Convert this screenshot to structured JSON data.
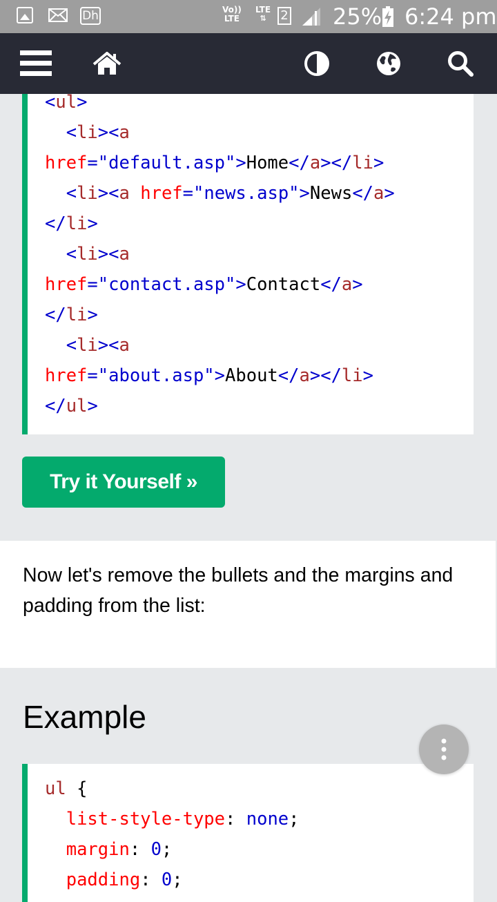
{
  "status_bar": {
    "dh_label": "Dh",
    "volte_top": "Vo))",
    "volte_bottom": "LTE",
    "lte_label": "LTE",
    "sim_slot": "2",
    "battery_percent": "25%",
    "time": "6:24 pm"
  },
  "nav": {
    "icons": [
      "menu-icon",
      "home-icon",
      "contrast-icon",
      "globe-icon",
      "search-icon"
    ],
    "background": "#282a35"
  },
  "code_example_1": {
    "lines": [
      [
        {
          "t": "tag",
          "v": "<"
        },
        {
          "t": "tn",
          "v": "ul"
        },
        {
          "t": "tag",
          "v": ">"
        }
      ],
      [
        {
          "t": "txt",
          "v": "  "
        },
        {
          "t": "tag",
          "v": "<"
        },
        {
          "t": "tn",
          "v": "li"
        },
        {
          "t": "tag",
          "v": "><"
        },
        {
          "t": "tn",
          "v": "a"
        }
      ],
      [
        {
          "t": "attr",
          "v": "href"
        },
        {
          "t": "val",
          "v": "=\"default.asp\""
        },
        {
          "t": "tag",
          "v": ">"
        },
        {
          "t": "txt",
          "v": "Home"
        },
        {
          "t": "tag",
          "v": "</"
        },
        {
          "t": "tn",
          "v": "a"
        },
        {
          "t": "tag",
          "v": "></"
        },
        {
          "t": "tn",
          "v": "li"
        },
        {
          "t": "tag",
          "v": ">"
        }
      ],
      [
        {
          "t": "txt",
          "v": "  "
        },
        {
          "t": "tag",
          "v": "<"
        },
        {
          "t": "tn",
          "v": "li"
        },
        {
          "t": "tag",
          "v": "><"
        },
        {
          "t": "tn",
          "v": "a"
        },
        {
          "t": "txt",
          "v": " "
        },
        {
          "t": "attr",
          "v": "href"
        },
        {
          "t": "val",
          "v": "=\"news.asp\""
        },
        {
          "t": "tag",
          "v": ">"
        },
        {
          "t": "txt",
          "v": "News"
        },
        {
          "t": "tag",
          "v": "</"
        },
        {
          "t": "tn",
          "v": "a"
        },
        {
          "t": "tag",
          "v": ">"
        }
      ],
      [
        {
          "t": "tag",
          "v": "</"
        },
        {
          "t": "tn",
          "v": "li"
        },
        {
          "t": "tag",
          "v": ">"
        }
      ],
      [
        {
          "t": "txt",
          "v": "  "
        },
        {
          "t": "tag",
          "v": "<"
        },
        {
          "t": "tn",
          "v": "li"
        },
        {
          "t": "tag",
          "v": "><"
        },
        {
          "t": "tn",
          "v": "a"
        }
      ],
      [
        {
          "t": "attr",
          "v": "href"
        },
        {
          "t": "val",
          "v": "=\"contact.asp\""
        },
        {
          "t": "tag",
          "v": ">"
        },
        {
          "t": "txt",
          "v": "Contact"
        },
        {
          "t": "tag",
          "v": "</"
        },
        {
          "t": "tn",
          "v": "a"
        },
        {
          "t": "tag",
          "v": ">"
        }
      ],
      [
        {
          "t": "tag",
          "v": "</"
        },
        {
          "t": "tn",
          "v": "li"
        },
        {
          "t": "tag",
          "v": ">"
        }
      ],
      [
        {
          "t": "txt",
          "v": "  "
        },
        {
          "t": "tag",
          "v": "<"
        },
        {
          "t": "tn",
          "v": "li"
        },
        {
          "t": "tag",
          "v": "><"
        },
        {
          "t": "tn",
          "v": "a"
        }
      ],
      [
        {
          "t": "attr",
          "v": "href"
        },
        {
          "t": "val",
          "v": "=\"about.asp\""
        },
        {
          "t": "tag",
          "v": ">"
        },
        {
          "t": "txt",
          "v": "About"
        },
        {
          "t": "tag",
          "v": "</"
        },
        {
          "t": "tn",
          "v": "a"
        },
        {
          "t": "tag",
          "v": "></"
        },
        {
          "t": "tn",
          "v": "li"
        },
        {
          "t": "tag",
          "v": ">"
        }
      ],
      [
        {
          "t": "tag",
          "v": "</"
        },
        {
          "t": "tn",
          "v": "ul"
        },
        {
          "t": "tag",
          "v": ">"
        }
      ]
    ]
  },
  "try_button": {
    "label": "Try it Yourself »",
    "color": "#04aa6d"
  },
  "description": {
    "text": "Now let's remove the bullets and the margins and padding from the list:"
  },
  "example_heading": "Example",
  "fab": {
    "icon": "more-vertical-icon"
  },
  "code_example_2": {
    "lines": [
      [
        {
          "t": "sel",
          "v": "ul"
        },
        {
          "t": "txt",
          "v": " {"
        }
      ],
      [
        {
          "t": "txt",
          "v": "  "
        },
        {
          "t": "prop",
          "v": "list-style-type"
        },
        {
          "t": "txt",
          "v": ": "
        },
        {
          "t": "pv",
          "v": "none"
        },
        {
          "t": "txt",
          "v": ";"
        }
      ],
      [
        {
          "t": "txt",
          "v": "  "
        },
        {
          "t": "prop",
          "v": "margin"
        },
        {
          "t": "txt",
          "v": ": "
        },
        {
          "t": "pv",
          "v": "0"
        },
        {
          "t": "txt",
          "v": ";"
        }
      ],
      [
        {
          "t": "txt",
          "v": "  "
        },
        {
          "t": "prop",
          "v": "padding"
        },
        {
          "t": "txt",
          "v": ": "
        },
        {
          "t": "pv",
          "v": "0"
        },
        {
          "t": "txt",
          "v": ";"
        }
      ]
    ]
  }
}
